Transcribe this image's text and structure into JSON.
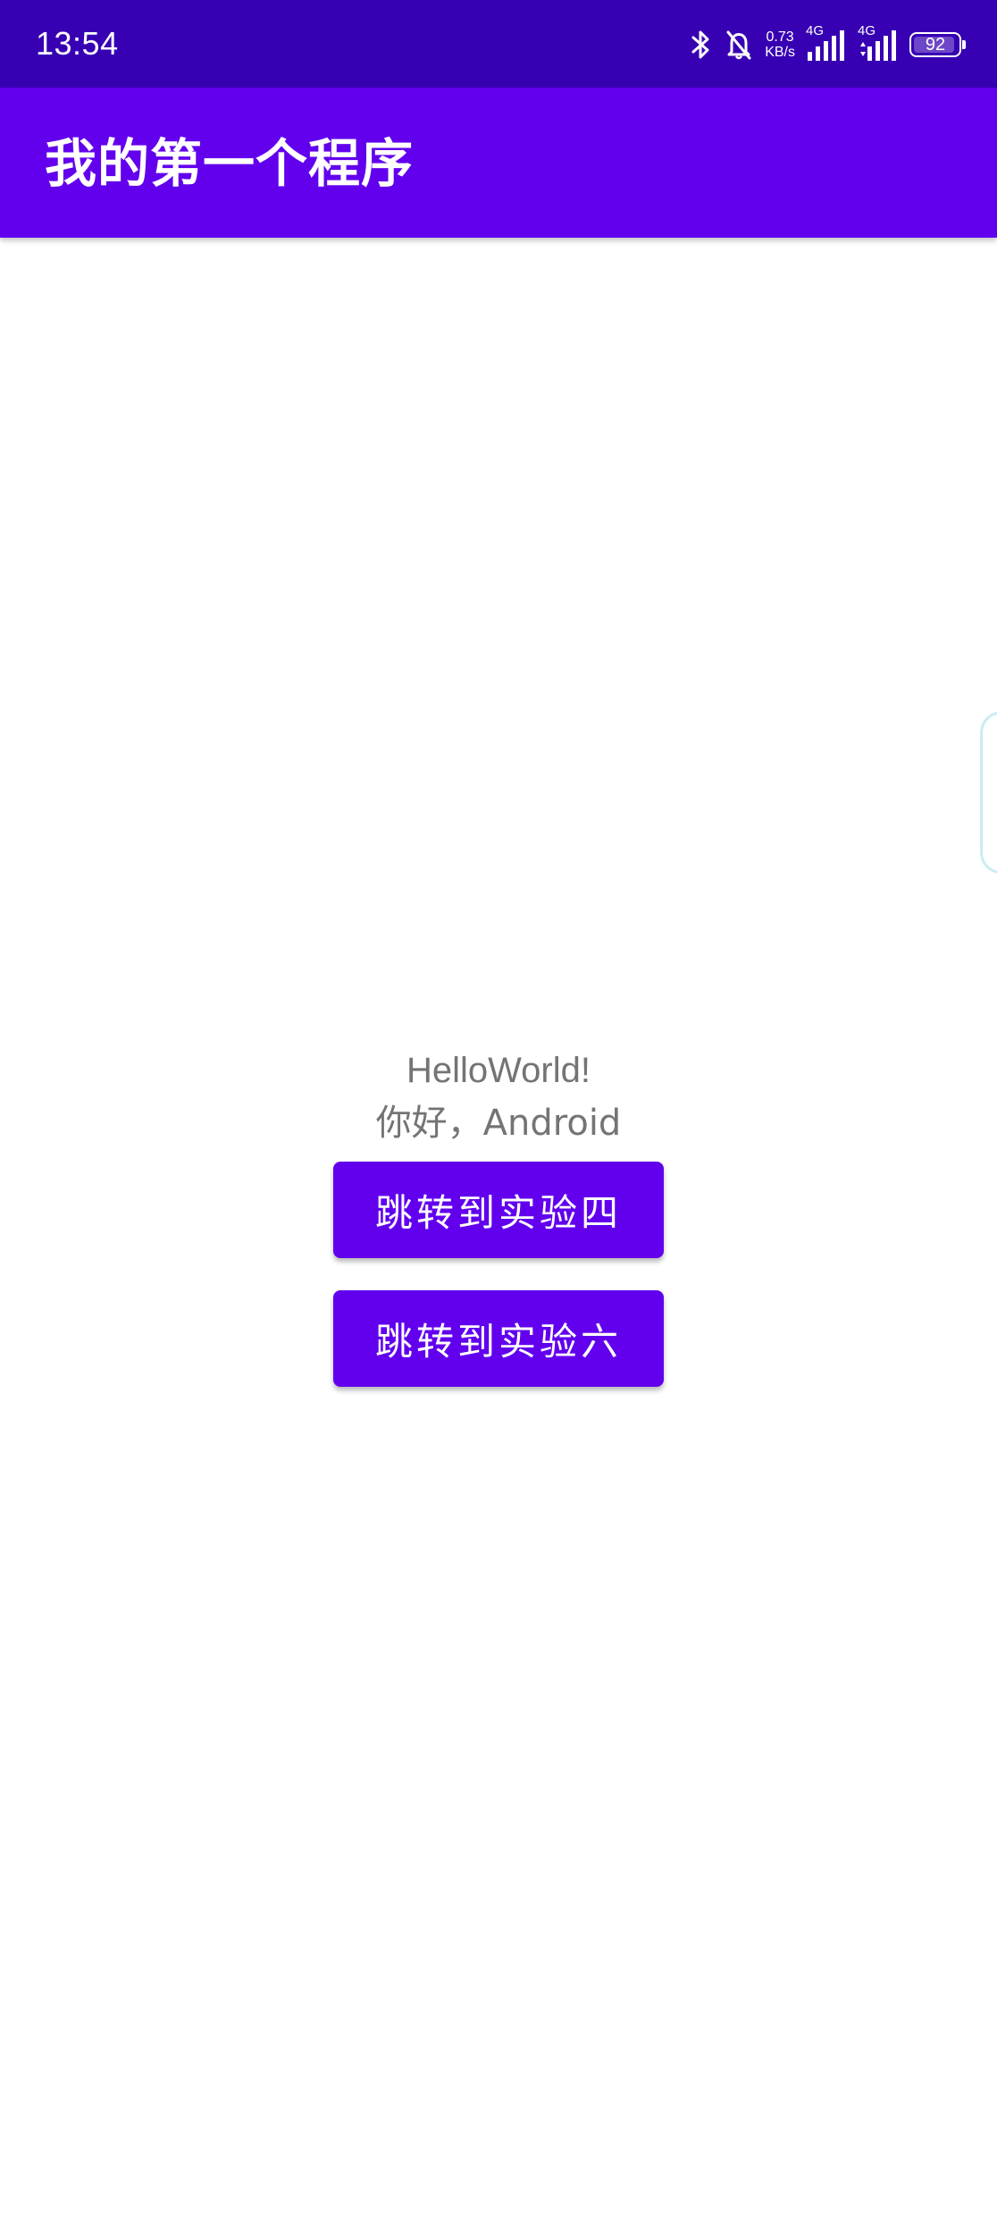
{
  "status_bar": {
    "time": "13:54",
    "net_speed_value": "0.73",
    "net_speed_unit": "KB/s",
    "signal_1_label": "4G",
    "signal_2_label": "4G",
    "battery_level": "92",
    "icons": [
      "bluetooth-icon",
      "bell-muted-icon",
      "signal-icon",
      "signal-icon",
      "battery-icon"
    ]
  },
  "app_bar": {
    "title": "我的第一个程序"
  },
  "main": {
    "hello_line_1": "HelloWorld!",
    "hello_line_2": "你好，Android",
    "button_1_label": "跳转到实验四",
    "button_2_label": "跳转到实验六"
  },
  "colors": {
    "status_bar": "#3700B3",
    "primary": "#6200EE",
    "text_secondary": "#747474",
    "background": "#FFFFFF"
  }
}
